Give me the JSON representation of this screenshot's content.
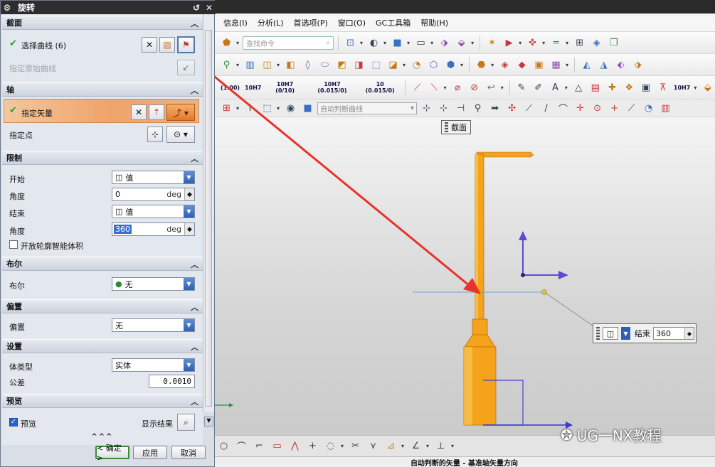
{
  "window": {
    "title": "旋转"
  },
  "menu": [
    "信息(I)",
    "分析(L)",
    "首选项(P)",
    "窗口(O)",
    "GC工具箱",
    "帮助(H)"
  ],
  "toolbar": {
    "search_placeholder": "查找命令",
    "tol_labels": [
      "(1.00)",
      "10H7",
      "10H7 (0/10)",
      "10H7 (0.015/0)",
      "10 (0.015/0)"
    ],
    "tol_label_right": "10H7",
    "filter_placeholder": "自动判断曲线"
  },
  "dialog": {
    "sections": {
      "section": "截面",
      "axis": "轴",
      "limits": "限制",
      "boolean": "布尔",
      "offset": "偏置",
      "settings": "设置",
      "preview": "预览"
    },
    "section": {
      "select_curve": "选择曲线 (6)",
      "specify_origin_curve": "指定原始曲线"
    },
    "axis": {
      "specify_vector": "指定矢量",
      "specify_point": "指定点"
    },
    "limits": {
      "start_label": "开始",
      "start_type": "值",
      "start_angle_label": "角度",
      "start_angle": "0",
      "start_unit": "deg",
      "end_label": "结束",
      "end_type": "值",
      "end_angle_label": "角度",
      "end_angle": "360",
      "end_unit": "deg",
      "open_profile_label": "开放轮廓智能体积"
    },
    "boolean": {
      "label": "布尔",
      "value": "无"
    },
    "offset": {
      "label": "偏置",
      "value": "无"
    },
    "settings": {
      "body_type_label": "体类型",
      "body_type": "实体",
      "tolerance_label": "公差",
      "tolerance": "0.0010"
    },
    "preview": {
      "preview_label": "预览",
      "show_result_label": "显示结果"
    },
    "buttons": {
      "ok": "< 确定 >",
      "apply": "应用",
      "cancel": "取消"
    }
  },
  "graphics": {
    "section_tag": "截面",
    "end_callout_label": "结束",
    "end_callout_value": "360",
    "watermark": "UG一NX教程"
  },
  "status": "自动判断的矢量 - 基准轴矢量方向",
  "colors": {
    "part": "#f5a31a",
    "highlight": "#f0a36a",
    "arrow": "#e8332b",
    "vector": "#5a4bd1"
  }
}
